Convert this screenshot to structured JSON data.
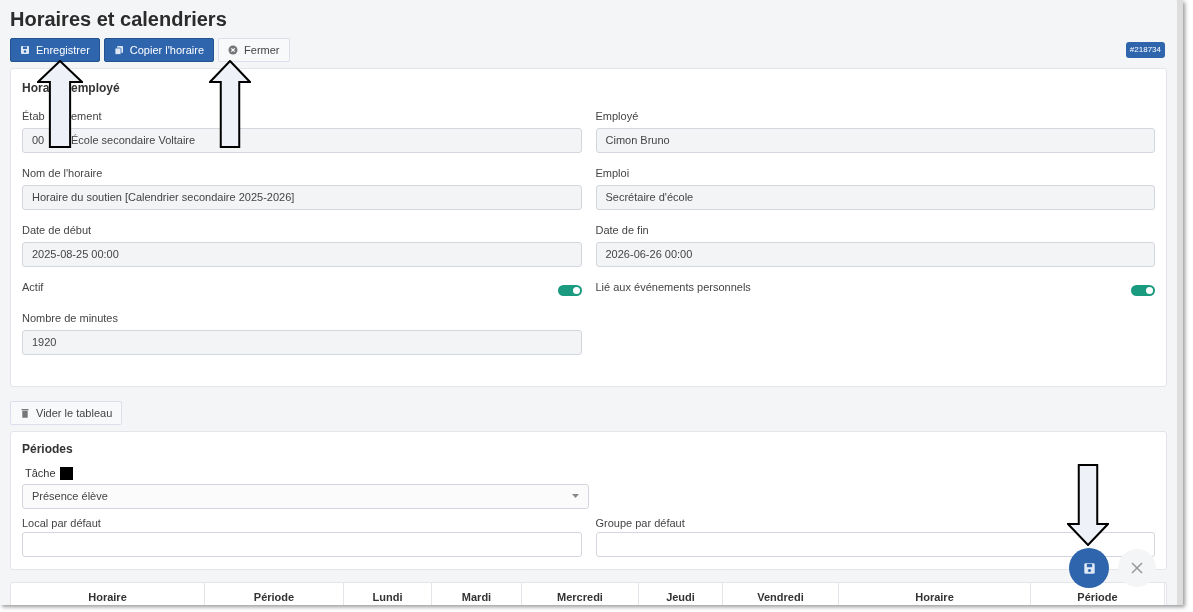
{
  "page_title": "Horaires et calendriers",
  "toolbar": [
    {
      "label": "Enregistrer",
      "kind": "primary"
    },
    {
      "label": "Copier l'horaire",
      "kind": "primary"
    },
    {
      "label": "Fermer",
      "kind": "light"
    }
  ],
  "record_badge": "#218734",
  "employee_section": {
    "title_parts": [
      "Hora",
      "employé"
    ],
    "fields": [
      {
        "kind": "text",
        "label_parts": [
          "Étab",
          "ement"
        ],
        "value_parts": [
          "00",
          "École secondaire Voltaire"
        ]
      },
      {
        "kind": "text",
        "label_parts": [
          "Employé"
        ],
        "value_parts": [
          "Cimon Bruno"
        ]
      },
      {
        "kind": "text",
        "label_parts": [
          "Nom de l'horaire"
        ],
        "value_parts": [
          "Horaire du soutien [Calendrier secondaire 2025-2026]"
        ]
      },
      {
        "kind": "text",
        "label_parts": [
          "Emploi"
        ],
        "value_parts": [
          "Secrétaire d'école"
        ]
      },
      {
        "kind": "text",
        "label_parts": [
          "Date de début"
        ],
        "value_parts": [
          "2025-08-25 00:00"
        ]
      },
      {
        "kind": "text",
        "label_parts": [
          "Date de fin"
        ],
        "value_parts": [
          "2026-06-26 00:00"
        ]
      },
      {
        "kind": "toggle",
        "label_parts": [
          "Actif"
        ],
        "on": true
      },
      {
        "kind": "toggle",
        "label_parts": [
          "Lié aux événements personnels"
        ],
        "on": true
      },
      {
        "kind": "text",
        "label_parts": [
          "Nombre de minutes"
        ],
        "value_parts": [
          "1920"
        ]
      }
    ]
  },
  "clear_button": "Vider le tableau",
  "periods_section": {
    "title": "Périodes",
    "task_label": "Tâche",
    "task_value": "Présence élève",
    "room_label": "Local par défaut",
    "group_label": "Groupe par défaut"
  },
  "table": {
    "columns": [
      "Horaire",
      "Période",
      "Lundi",
      "Mardi",
      "Mercredi",
      "Jeudi",
      "Vendredi",
      "Horaire",
      "Période"
    ]
  }
}
